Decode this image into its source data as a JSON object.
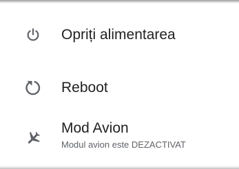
{
  "menu": {
    "items": [
      {
        "icon": "power-icon",
        "label": "Opriți alimentarea"
      },
      {
        "icon": "reboot-icon",
        "label": "Reboot"
      },
      {
        "icon": "airplane-icon",
        "label": "Mod Avion",
        "sublabel": "Modul avion este DEZACTIVAT"
      }
    ]
  },
  "colors": {
    "background": "#ffffff",
    "text_primary": "#212121",
    "text_secondary": "#5f6368",
    "icon": "#5f6368"
  }
}
